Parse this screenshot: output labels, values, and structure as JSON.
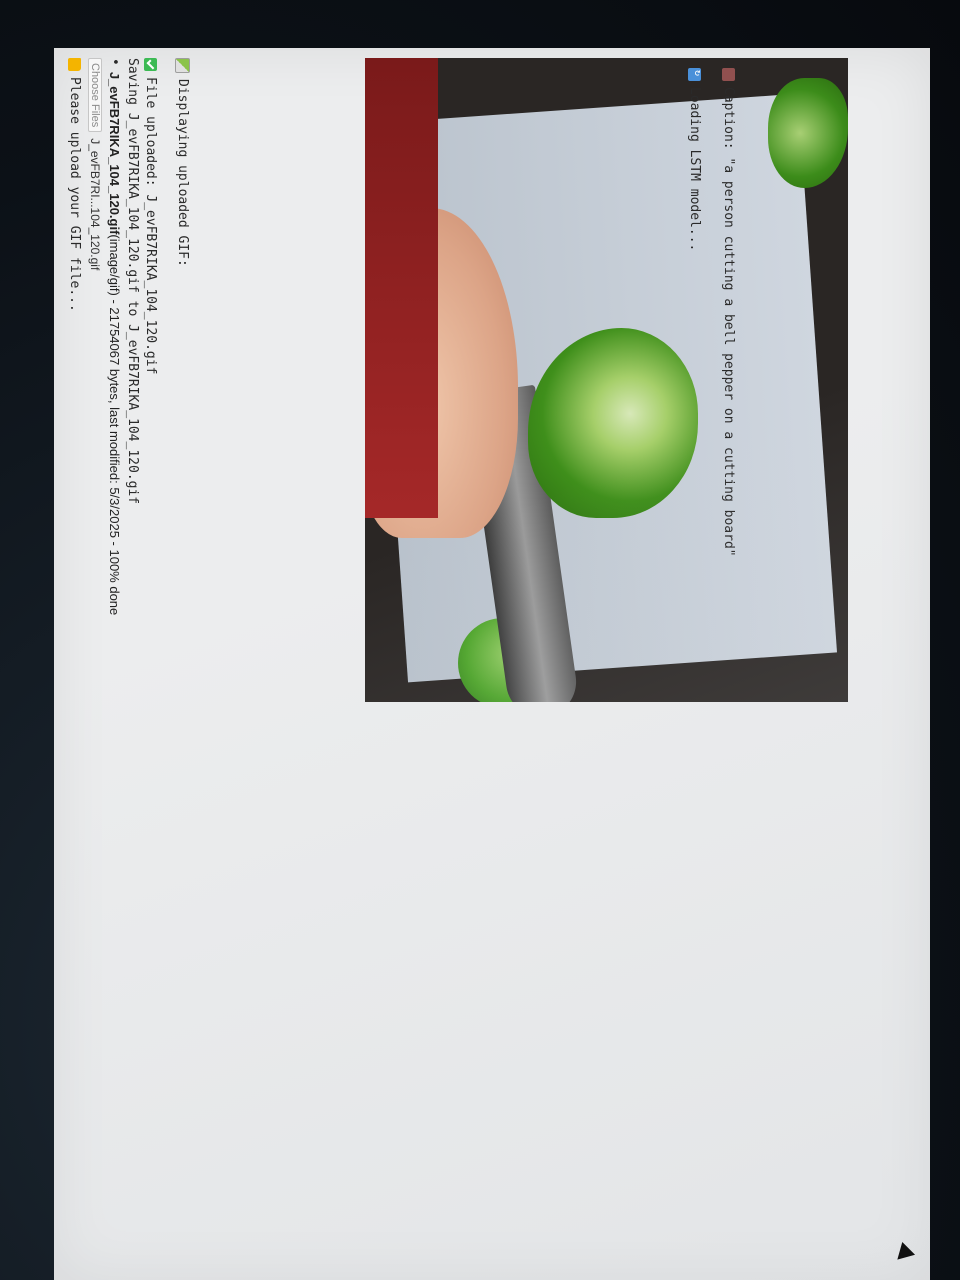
{
  "prompt": {
    "text": "Please upload your GIF file..."
  },
  "file_input": {
    "button_label": "Choose Files",
    "selected_name": "J_evFB7RI...104_120.gif"
  },
  "upload_summary": {
    "filename": "J_evFB7RIKA_104_120.gif",
    "details": "(image/gif) - 21754067 bytes, last modified: 5/3/2025 - 100% done"
  },
  "log": {
    "saving": "Saving J_evFB7RIKA_104_120.gif to J_evFB7RIKA_104_120.gif",
    "uploaded": "File uploaded: J_evFB7RIKA_104_120.gif",
    "displaying": "Displaying uploaded GIF:",
    "loading": "Loading LSTM model...",
    "caption": "Caption: \"a person cutting a bell pepper on a cutting board\""
  },
  "icons": {
    "prompt": "folder-icon",
    "uploaded": "check-icon",
    "displaying": "image-icon",
    "loading": "refresh-icon",
    "caption": "puzzle-icon"
  },
  "colors": {
    "screen_bg": "#ecedee",
    "bezel": "#0b1016",
    "check": "#3cba54",
    "folder": "#f4b400",
    "info": "#4a90d9"
  }
}
